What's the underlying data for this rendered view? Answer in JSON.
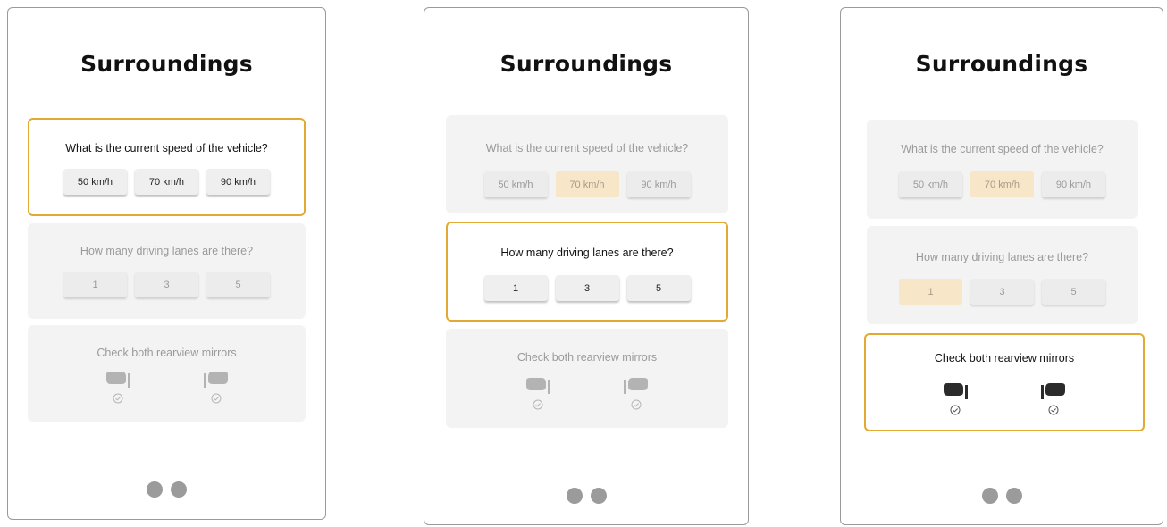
{
  "screens": [
    {
      "title": "Surroundings",
      "active_card": "speed",
      "speed": {
        "question": "What is the current speed of the vehicle?",
        "options": [
          "50 km/h",
          "70 km/h",
          "90 km/h"
        ],
        "selected": null
      },
      "lanes": {
        "question": "How many driving lanes are there?",
        "options": [
          "1",
          "3",
          "5"
        ],
        "selected": null
      },
      "mirrors": {
        "question": "Check both rearview mirrors",
        "items": [
          "left-mirror-icon",
          "right-mirror-icon"
        ],
        "checked": [
          false,
          false
        ]
      },
      "page_dots": 2
    },
    {
      "title": "Surroundings",
      "active_card": "lanes",
      "speed": {
        "question": "What is the current speed of the vehicle?",
        "options": [
          "50 km/h",
          "70 km/h",
          "90 km/h"
        ],
        "selected": "70 km/h"
      },
      "lanes": {
        "question": "How many driving lanes are there?",
        "options": [
          "1",
          "3",
          "5"
        ],
        "selected": null
      },
      "mirrors": {
        "question": "Check both rearview mirrors",
        "items": [
          "left-mirror-icon",
          "right-mirror-icon"
        ],
        "checked": [
          false,
          false
        ]
      },
      "page_dots": 2
    },
    {
      "title": "Surroundings",
      "active_card": "mirrors",
      "speed": {
        "question": "What is the current speed of the vehicle?",
        "options": [
          "50 km/h",
          "70 km/h",
          "90 km/h"
        ],
        "selected": "70 km/h"
      },
      "lanes": {
        "question": "How many driving lanes are there?",
        "options": [
          "1",
          "3",
          "5"
        ],
        "selected": "1"
      },
      "mirrors": {
        "question": "Check both rearview mirrors",
        "items": [
          "left-mirror-icon",
          "right-mirror-icon"
        ],
        "checked": [
          false,
          false
        ]
      },
      "page_dots": 2
    }
  ],
  "colors": {
    "active_border": "#e3a935",
    "selected_option": "#f8e6c8",
    "inactive_card": "#f3f3f3",
    "dot": "#9b9b9b"
  }
}
